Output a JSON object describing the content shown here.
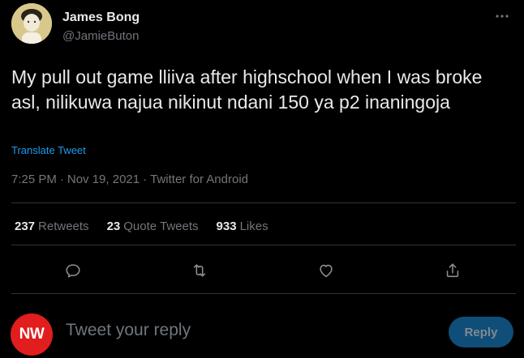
{
  "author": {
    "display_name": "James Bong",
    "handle": "@JamieButon",
    "avatar_icon": "user-avatar"
  },
  "more_icon": "more-horizontal-icon",
  "tweet": {
    "text": "My pull out game lliiva after highschool when I was broke asl, nilikuwa najua nikinut ndani 150 ya p2 inaningoja",
    "translate_label": "Translate Tweet",
    "time": "7:25 PM",
    "separator": "·",
    "date": "Nov 19, 2021",
    "source": "Twitter for Android"
  },
  "stats": {
    "retweets_count": "237",
    "retweets_label": "Retweets",
    "quote_count": "23",
    "quote_label": "Quote Tweets",
    "likes_count": "933",
    "likes_label": "Likes"
  },
  "actions": [
    "reply-icon",
    "retweet-icon",
    "like-icon",
    "share-icon"
  ],
  "reply": {
    "avatar_text": "NW",
    "placeholder": "Tweet your reply",
    "button_label": "Reply"
  },
  "colors": {
    "background": "#000000",
    "text": "#e7e9ea",
    "secondary": "#71767b",
    "link": "#1d9bf0",
    "divider": "#2f3336",
    "reply_button": "#0f4e78",
    "nw_red": "#e11d1d"
  }
}
